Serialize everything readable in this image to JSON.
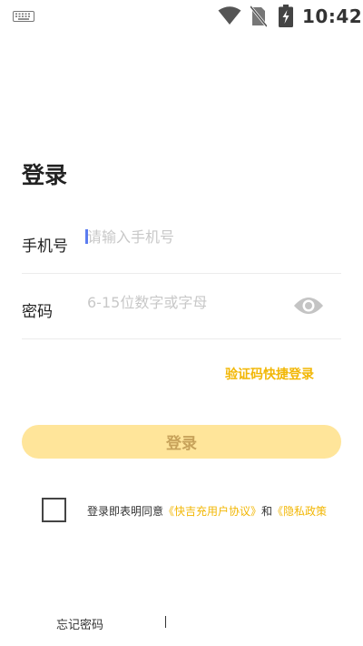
{
  "status_bar": {
    "time": "10:42",
    "icons": [
      "keyboard-icon",
      "wifi-icon",
      "no-sim-icon",
      "battery-charging-icon"
    ]
  },
  "login": {
    "title": "登录",
    "phone_label": "手机号",
    "phone_placeholder": "请输入手机号",
    "phone_value": "",
    "password_label": "密码",
    "password_placeholder": "6-15位数字或字母",
    "password_value": "",
    "sms_login_link": "验证码快捷登录",
    "login_button": "登录",
    "agreement": {
      "prefix": "登录即表明同意",
      "user_agreement": "《快吉充用户协议》",
      "and": "和",
      "privacy_policy": "《隐私政策"
    },
    "agree_checked": false
  },
  "footer": {
    "forgot_password": "忘记密码"
  },
  "colors": {
    "accent": "#f2b705",
    "button_bg": "#ffe59a",
    "button_text": "#c7a25a",
    "placeholder": "#c8c8c8",
    "cursor": "#5b7cf0"
  }
}
